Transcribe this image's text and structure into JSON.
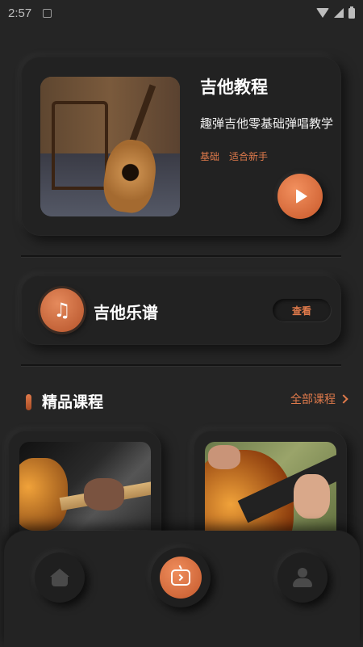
{
  "status_bar": {
    "time": "2:57"
  },
  "hero": {
    "title": "吉他教程",
    "subtitle": "趣弹吉他零基础弹唱教学",
    "tags": [
      "基础",
      "适合新手"
    ]
  },
  "score": {
    "title": "吉他乐谱",
    "view_label": "查看",
    "icon": "♫"
  },
  "courses_section": {
    "title": "精品课程",
    "more_label": "全部课程"
  },
  "colors": {
    "accent": "#e07a4b",
    "background": "#252525",
    "card": "#222222"
  },
  "icons": {
    "home": "home-icon",
    "center": "play-box-icon",
    "profile": "profile-icon"
  }
}
